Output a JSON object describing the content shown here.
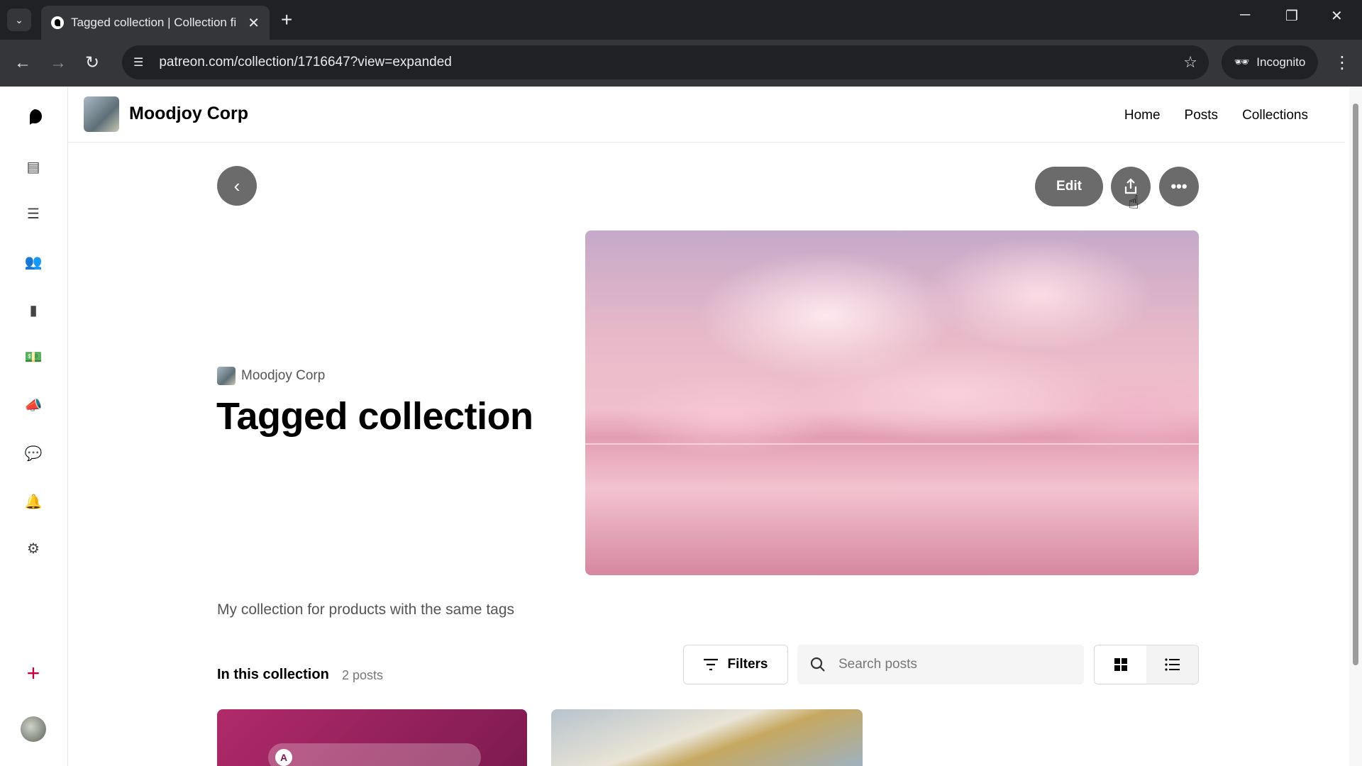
{
  "browser": {
    "tab_title": "Tagged collection | Collection fi",
    "url": "patreon.com/collection/1716647?view=expanded",
    "incognito_label": "Incognito"
  },
  "header": {
    "creator_name": "Moodjoy Corp",
    "nav": [
      {
        "label": "Home"
      },
      {
        "label": "Posts"
      },
      {
        "label": "Collections"
      }
    ]
  },
  "collection": {
    "creator_name": "Moodjoy Corp",
    "title": "Tagged collection",
    "description": "My collection for products with the same tags",
    "edit_label": "Edit",
    "section_label": "In this collection",
    "post_count": "2 posts",
    "filters_label": "Filters",
    "search_placeholder": "Search posts",
    "card1_letter": "A"
  },
  "icons": {
    "back": "chevron-left-icon",
    "share": "share-icon",
    "more": "more-horizontal-icon"
  },
  "colors": {
    "button_gray": "#6b6b6b",
    "accent_red": "#c8003c"
  }
}
